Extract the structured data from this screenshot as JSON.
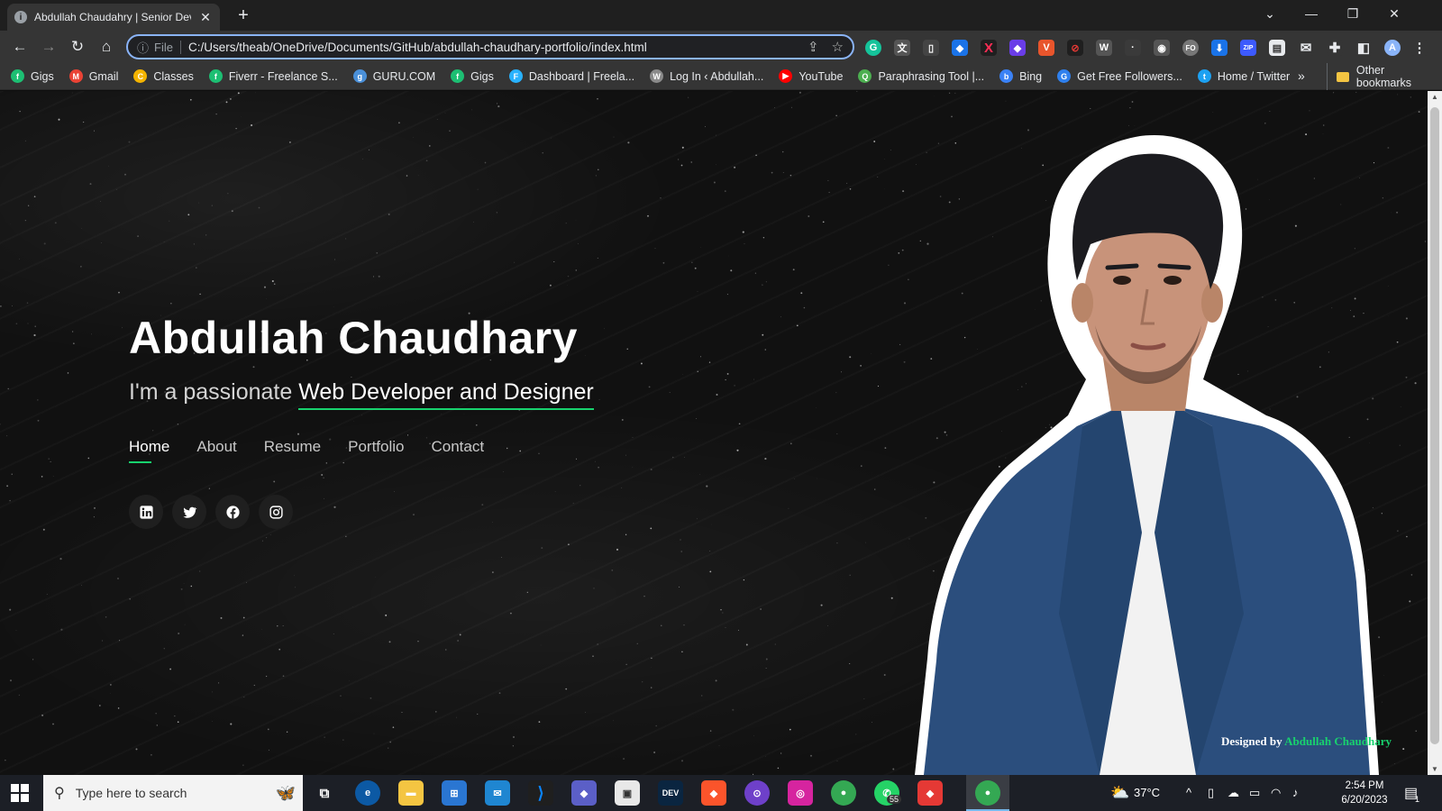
{
  "browser": {
    "tab_title": "Abdullah Chaudahry | Senior Dev",
    "address_scheme": "File",
    "address_url": "C:/Users/theab/OneDrive/Documents/GitHub/abdullah-chaudhary-portfolio/index.html"
  },
  "bookmarks": [
    {
      "label": "Gigs",
      "icon": "fiverr-icon",
      "color": "#1dbf73",
      "glyph": "f"
    },
    {
      "label": "Gmail",
      "icon": "gmail-icon",
      "color": "#ea4335",
      "glyph": "M"
    },
    {
      "label": "Classes",
      "icon": "classroom-icon",
      "color": "#f4b400",
      "glyph": "C"
    },
    {
      "label": "Fiverr - Freelance S...",
      "icon": "fiverr-icon",
      "color": "#1dbf73",
      "glyph": "f"
    },
    {
      "label": "GURU.COM",
      "icon": "guru-icon",
      "color": "#4a90d9",
      "glyph": "g"
    },
    {
      "label": "Gigs",
      "icon": "fiverr-icon",
      "color": "#1dbf73",
      "glyph": "f"
    },
    {
      "label": "Dashboard | Freela...",
      "icon": "freelancer-icon",
      "color": "#29b2fe",
      "glyph": "F"
    },
    {
      "label": "Log In ‹ Abdullah...",
      "icon": "wordpress-icon",
      "color": "#8a8a8a",
      "glyph": "W"
    },
    {
      "label": "YouTube",
      "icon": "youtube-icon",
      "color": "#ff0000",
      "glyph": "▶"
    },
    {
      "label": "Paraphrasing Tool |...",
      "icon": "quillbot-icon",
      "color": "#4caf50",
      "glyph": "Q"
    },
    {
      "label": "Bing",
      "icon": "bing-search-icon",
      "color": "#3b82f6",
      "glyph": "b"
    },
    {
      "label": "Get Free Followers...",
      "icon": "followers-icon",
      "color": "#2f80ed",
      "glyph": "G"
    },
    {
      "label": "Home / Twitter",
      "icon": "twitter-icon",
      "color": "#1da1f2",
      "glyph": "t"
    }
  ],
  "other_bookmarks": "Other bookmarks",
  "hero": {
    "name": "Abdullah Chaudhary",
    "subtitle_prefix": "I'm a passionate ",
    "subtitle_highlight": "Web Developer and Designer",
    "nav": [
      "Home",
      "About",
      "Resume",
      "Portfolio",
      "Contact"
    ],
    "active_nav": "Home",
    "socials": [
      "linkedin-icon",
      "twitter-icon",
      "facebook-icon",
      "instagram-icon"
    ],
    "accent_color": "#18d26e"
  },
  "credit": {
    "prefix": "Designed  by",
    "name": "Abdullah  Chaudhary"
  },
  "taskbar": {
    "search_placeholder": "Type here to search",
    "weather": "37°C",
    "time": "2:54 PM",
    "date": "6/20/2023",
    "whatsapp_badge": "55",
    "notification_count": "1"
  }
}
